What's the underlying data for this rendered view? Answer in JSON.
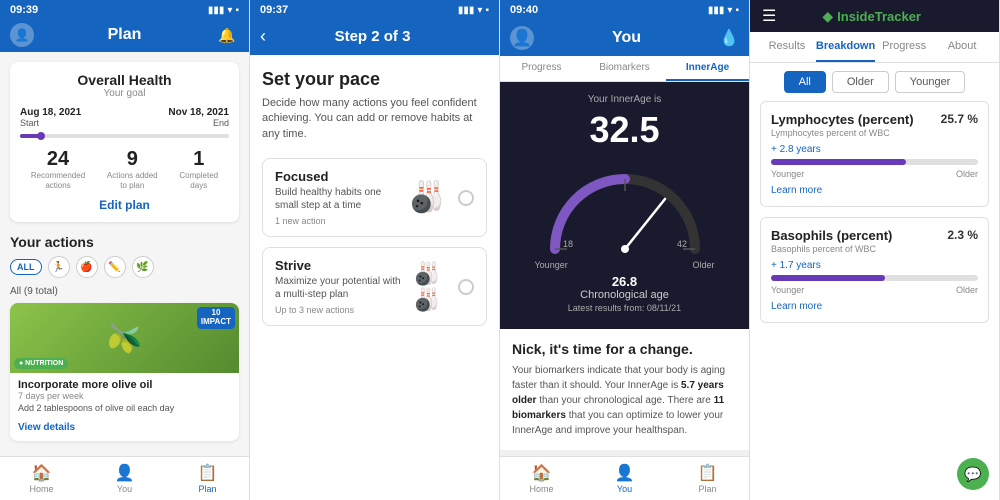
{
  "panel1": {
    "status_time": "09:39",
    "header_title": "Plan",
    "overall_health": {
      "title": "Overall Health",
      "subtitle": "Your goal",
      "start_date": "Aug 18, 2021",
      "start_label": "Start",
      "end_date": "Nov 18, 2021",
      "end_label": "End",
      "stats": [
        {
          "num": "24",
          "label": "Recommended\nactions"
        },
        {
          "num": "9",
          "label": "Actions added\nto plan"
        },
        {
          "num": "1",
          "label": "Completed\ndays"
        }
      ],
      "edit_label": "Edit plan"
    },
    "your_actions": {
      "title": "Your actions",
      "filters": [
        "ALL"
      ],
      "all_label": "All (9 total)",
      "action": {
        "badge_num": "10",
        "badge_label": "IMPACT",
        "nutrition_tag": "● NUTRITION",
        "title": "Incorporate more olive oil",
        "freq": "7 days per week",
        "desc": "Add 2 tablespoons of olive oil each day",
        "link": "View details"
      }
    },
    "nav": [
      {
        "label": "Home",
        "icon": "🏠",
        "active": false
      },
      {
        "label": "You",
        "icon": "👤",
        "active": false
      },
      {
        "label": "Plan",
        "icon": "📋",
        "active": true
      }
    ]
  },
  "panel2": {
    "status_time": "09:37",
    "step_label": "Step 2 of 3",
    "main_title": "Set your pace",
    "desc": "Decide how many actions you feel confident achieving. You can add or remove habits at any time.",
    "cards": [
      {
        "title": "Focused",
        "desc": "Build healthy habits one small step at a time",
        "action": "1 new action",
        "icon": "🎳"
      },
      {
        "title": "Strive",
        "desc": "Maximize your potential with a multi-step plan",
        "action": "Up to 3 new actions",
        "icon": "🎳"
      }
    ]
  },
  "panel3": {
    "status_time": "09:40",
    "header_title": "You",
    "tabs": [
      {
        "label": "Progress",
        "active": false
      },
      {
        "label": "Biomarkers",
        "active": false
      },
      {
        "label": "InnerAge",
        "active": true
      }
    ],
    "innerage": {
      "label": "Your InnerAge is",
      "number": "32.5",
      "gauge_min": "18",
      "gauge_mid": "42",
      "younger_label": "Younger",
      "older_label": "Older",
      "chrono_label": "Chronological age",
      "chrono_num": "26.8",
      "latest": "Latest results from: 08/11/21"
    },
    "message": {
      "title": "Nick, it's time for a change.",
      "text_plain": "Your biomarkers indicate that your body is aging faster than it should. Your InnerAge is ",
      "highlight": "5.7 years older",
      "text2": " than your chronological age. There are ",
      "highlight2": "11 biomarkers",
      "text3": " that you can optimize to lower your InnerAge and improve your healthspan."
    },
    "nav": [
      {
        "label": "Home",
        "icon": "🏠",
        "active": false
      },
      {
        "label": "You",
        "icon": "👤",
        "active": true
      },
      {
        "label": "Plan",
        "icon": "📋",
        "active": false
      }
    ]
  },
  "panel4": {
    "logo": {
      "icon": "◆",
      "brand": "Inside",
      "brand_accent": "Tracker"
    },
    "nav_items": [
      {
        "label": "Results",
        "active": false
      },
      {
        "label": "Breakdown",
        "active": true
      },
      {
        "label": "Progress",
        "active": false
      },
      {
        "label": "About",
        "active": false
      }
    ],
    "filters": [
      {
        "label": "All",
        "active": true
      },
      {
        "label": "Older",
        "active": false
      },
      {
        "label": "Younger",
        "active": false
      }
    ],
    "biomarkers": [
      {
        "title": "Lymphocytes (percent)",
        "subtitle": "Lymphocytes percent of WBC",
        "value": "25.7 %",
        "delta": "+ 2.8 years",
        "bar_pct": 65,
        "younger": "Younger",
        "older": "Older",
        "learn": "Learn more"
      },
      {
        "title": "Basophils (percent)",
        "subtitle": "Basophils percent of WBC",
        "value": "2.3 %",
        "delta": "+ 1.7 years",
        "bar_pct": 55,
        "younger": "Younger",
        "older": "Older",
        "learn": "Learn more"
      }
    ],
    "chat_icon": "💬"
  }
}
